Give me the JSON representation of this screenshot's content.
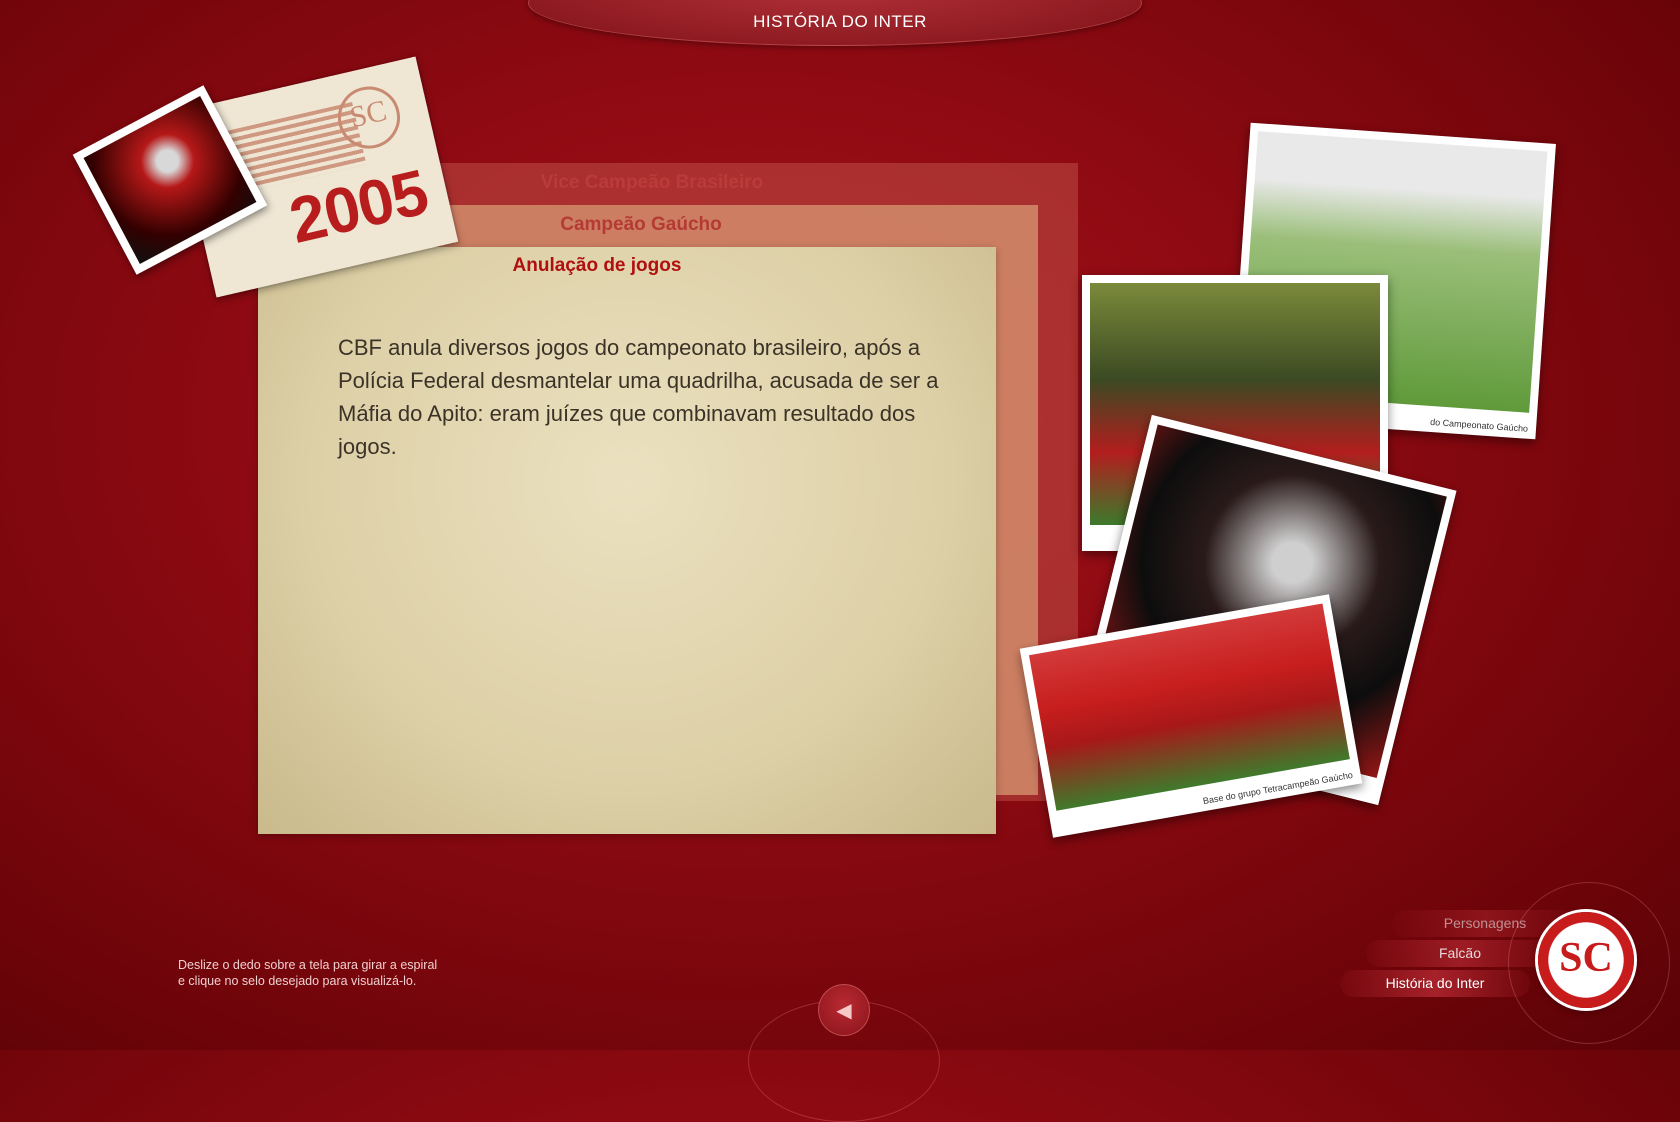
{
  "header": {
    "title": "HISTÓRIA DO INTER"
  },
  "stamp": {
    "year": "2005",
    "emblem": "SC"
  },
  "cards": [
    {
      "title": "Vice Campeão Brasileiro"
    },
    {
      "title": "Campeão Gaúcho"
    },
    {
      "title": "Anulação de jogos",
      "body": "CBF anula diversos jogos do campeonato brasileiro, após a Polícia Federal desmantelar uma quadrilha, acusada de ser a Máfia do Apito: eram juízes que combinavam resultado dos jogos."
    }
  ],
  "photos": [
    {
      "caption": "do Campeonato Gaúcho"
    },
    {
      "caption": ""
    },
    {
      "caption": ""
    },
    {
      "caption": "Base do grupo Tetracampeão Gaúcho"
    }
  ],
  "nav": {
    "items": [
      "Personagens",
      "Falcão",
      "História do Inter"
    ]
  },
  "hint": {
    "line1": "Deslize o dedo sobre a tela para girar a espiral",
    "line2": "e clique no selo desejado para visualizá-lo."
  },
  "back": {
    "icon": "◀"
  },
  "logo": {
    "mark": "SC"
  }
}
